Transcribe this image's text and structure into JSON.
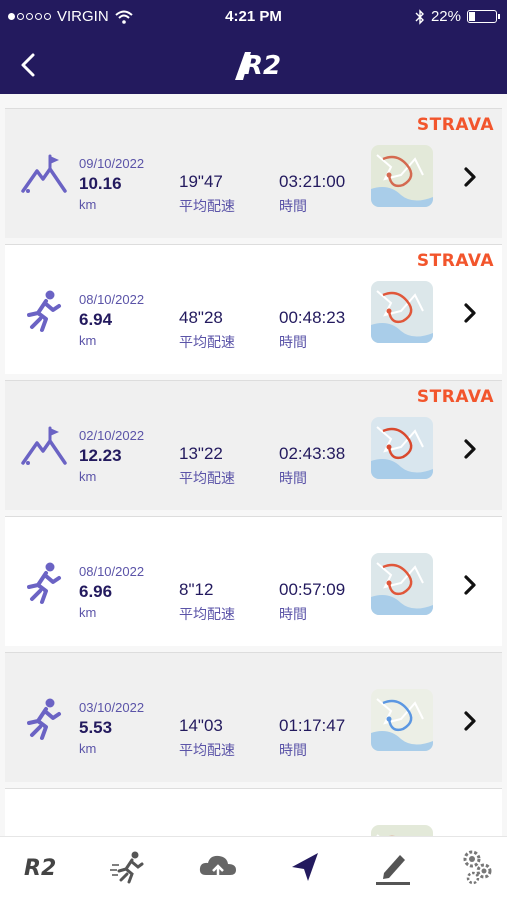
{
  "status_bar": {
    "carrier": "VIRGIN",
    "time": "4:21 PM",
    "battery": "22%",
    "battery_level": 0.22
  },
  "nav": {
    "logo_text": "R2"
  },
  "activities": [
    {
      "date": "09/10/2022",
      "distance": "10.16",
      "unit": "km",
      "pace": "19\"47",
      "pace_label": "平均配速",
      "duration": "03:21:00",
      "duration_label": "時間",
      "type": "hike-icon",
      "strava": "STRAVA"
    },
    {
      "date": "08/10/2022",
      "distance": "6.94",
      "unit": "km",
      "pace": "48\"28",
      "pace_label": "平均配速",
      "duration": "00:48:23",
      "duration_label": "時間",
      "type": "run-icon",
      "strava": "STRAVA"
    },
    {
      "date": "02/10/2022",
      "distance": "12.23",
      "unit": "km",
      "pace": "13\"22",
      "pace_label": "平均配速",
      "duration": "02:43:38",
      "duration_label": "時間",
      "type": "hike-icon",
      "strava": "STRAVA"
    },
    {
      "date": "08/10/2022",
      "distance": "6.96",
      "unit": "km",
      "pace": "8\"12",
      "pace_label": "平均配速",
      "duration": "00:57:09",
      "duration_label": "時間",
      "type": "run-icon",
      "strava": ""
    },
    {
      "date": "03/10/2022",
      "distance": "5.53",
      "unit": "km",
      "pace": "14\"03",
      "pace_label": "平均配速",
      "duration": "01:17:47",
      "duration_label": "時間",
      "type": "run-icon",
      "strava": ""
    }
  ],
  "tabs": [
    {
      "name": "r2-home-icon",
      "text": "R2"
    },
    {
      "name": "runner-icon"
    },
    {
      "name": "cloud-upload-icon"
    },
    {
      "name": "navigation-arrow-icon"
    },
    {
      "name": "edit-pencil-icon"
    },
    {
      "name": "settings-gears-icon"
    }
  ],
  "colors": {
    "navy": "#231a5e",
    "accent": "#6b63c4",
    "strava": "#f2552c"
  }
}
